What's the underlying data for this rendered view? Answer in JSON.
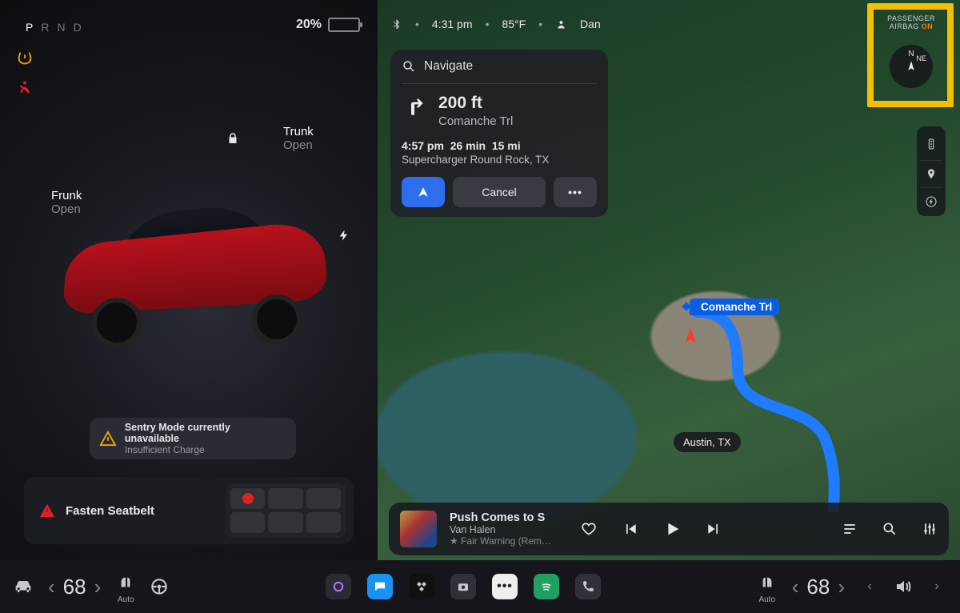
{
  "prnd": {
    "p": "P",
    "r": "R",
    "n": "N",
    "d": "D",
    "active": "P"
  },
  "battery": {
    "percent": "20%",
    "fill_pct": 20,
    "fill_color": "#f2c200"
  },
  "car": {
    "frunk_label": "Frunk",
    "frunk_state": "Open",
    "trunk_label": "Trunk",
    "trunk_state": "Open"
  },
  "sentry": {
    "line1": "Sentry Mode currently unavailable",
    "line2": "Insufficient Charge"
  },
  "fasten": {
    "text": "Fasten Seatbelt"
  },
  "map_status": {
    "time": "4:31 pm",
    "temp": "85°F",
    "user": "Dan"
  },
  "nav": {
    "search_label": "Navigate",
    "next_distance": "200 ft",
    "next_road": "Comanche Trl",
    "eta": "4:57 pm",
    "duration": "26 min",
    "distance": "15 mi",
    "destination": "Supercharger Round Rock, TX",
    "cancel_label": "Cancel"
  },
  "road_label": "Comanche Trl",
  "city_label": "Austin, TX",
  "airbag": {
    "line1": "PASSENGER",
    "line2": "AIRBAG",
    "state": "ON"
  },
  "compass": {
    "n": "N",
    "ne": "NE"
  },
  "media": {
    "title": "Push Comes to S",
    "artist": "Van Halen",
    "album": "Fair Warning (Rem…"
  },
  "dock": {
    "temp_left": "68",
    "temp_right": "68",
    "seat_auto_label": "Auto"
  },
  "colors": {
    "accent_blue": "#2f6def",
    "warn_red": "#d22",
    "warn_amber": "#f2a900"
  }
}
